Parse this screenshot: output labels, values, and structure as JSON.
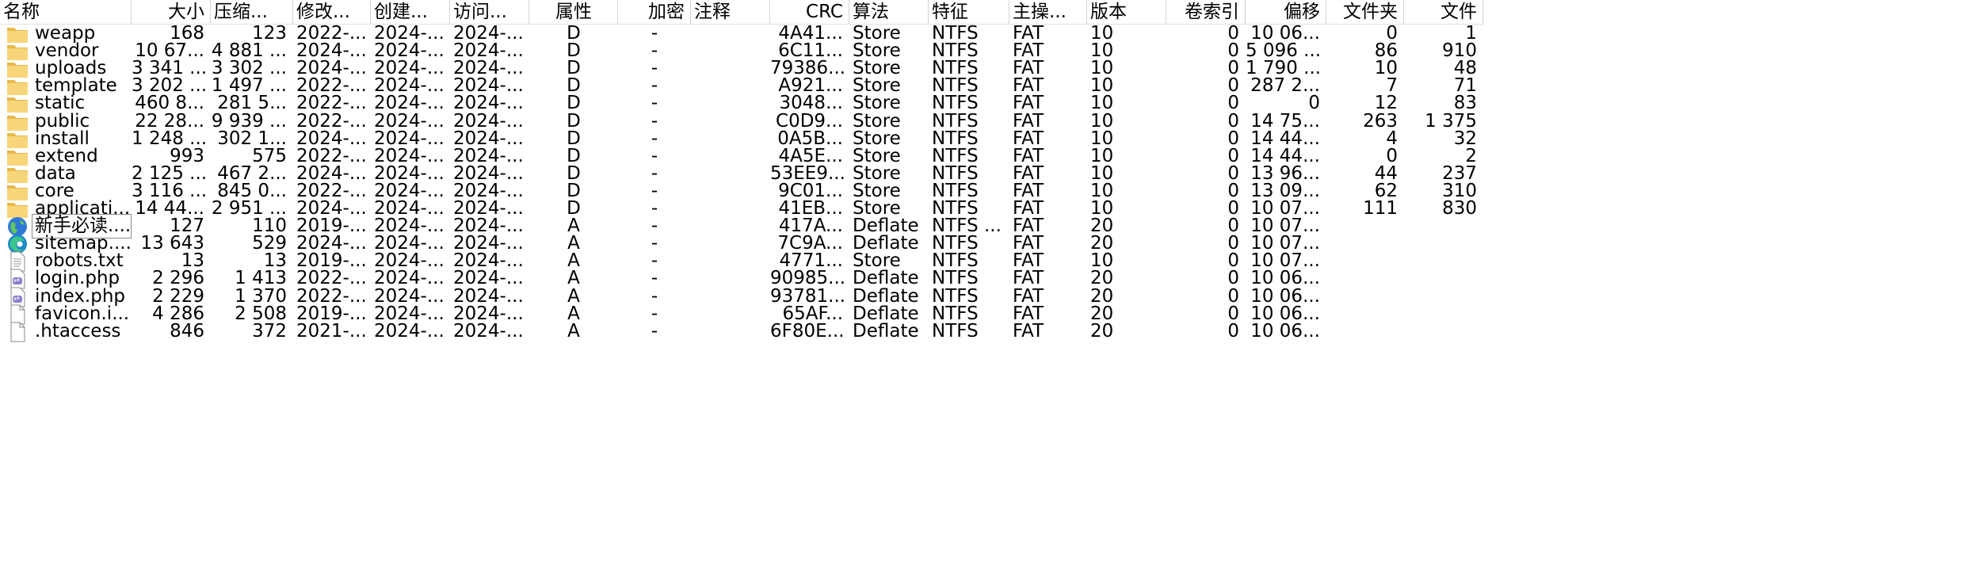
{
  "columns": [
    {
      "key": "name",
      "label": "名称"
    },
    {
      "key": "size",
      "label": "大小"
    },
    {
      "key": "packed",
      "label": "压缩..."
    },
    {
      "key": "modified",
      "label": "修改..."
    },
    {
      "key": "created",
      "label": "创建..."
    },
    {
      "key": "accessed",
      "label": "访问..."
    },
    {
      "key": "attr",
      "label": "属性"
    },
    {
      "key": "enc",
      "label": "加密"
    },
    {
      "key": "comment",
      "label": "注释"
    },
    {
      "key": "crc",
      "label": "CRC"
    },
    {
      "key": "method",
      "label": "算法"
    },
    {
      "key": "feature",
      "label": "特征"
    },
    {
      "key": "host",
      "label": "主操..."
    },
    {
      "key": "version",
      "label": "版本"
    },
    {
      "key": "volindex",
      "label": "卷索引"
    },
    {
      "key": "offset",
      "label": "偏移"
    },
    {
      "key": "folders",
      "label": "文件夹"
    },
    {
      "key": "files",
      "label": "文件"
    }
  ],
  "rows": [
    {
      "icon": "folder-icon",
      "name": "weapp",
      "size": "168",
      "packed": "123",
      "modified": "2022-...",
      "created": "2024-...",
      "accessed": "2024-...",
      "attr": "D",
      "enc": "-",
      "comment": "",
      "crc": "4A41...",
      "method": "Store",
      "feature": "NTFS",
      "host": "FAT",
      "version": "10",
      "volindex": "0",
      "offset": "10 06...",
      "folders": "0",
      "files": "1"
    },
    {
      "icon": "folder-icon",
      "name": "vendor",
      "size": "10 67...",
      "packed": "4 881 ...",
      "modified": "2024-...",
      "created": "2024-...",
      "accessed": "2024-...",
      "attr": "D",
      "enc": "-",
      "comment": "",
      "crc": "6C11...",
      "method": "Store",
      "feature": "NTFS",
      "host": "FAT",
      "version": "10",
      "volindex": "0",
      "offset": "5 096 ...",
      "folders": "86",
      "files": "910"
    },
    {
      "icon": "folder-icon",
      "name": "uploads",
      "size": "3 341 ...",
      "packed": "3 302 ...",
      "modified": "2024-...",
      "created": "2024-...",
      "accessed": "2024-...",
      "attr": "D",
      "enc": "-",
      "comment": "",
      "crc": "79386...",
      "method": "Store",
      "feature": "NTFS",
      "host": "FAT",
      "version": "10",
      "volindex": "0",
      "offset": "1 790 ...",
      "folders": "10",
      "files": "48"
    },
    {
      "icon": "folder-icon",
      "name": "template",
      "size": "3 202 ...",
      "packed": "1 497 ...",
      "modified": "2022-...",
      "created": "2024-...",
      "accessed": "2024-...",
      "attr": "D",
      "enc": "-",
      "comment": "",
      "crc": "A921...",
      "method": "Store",
      "feature": "NTFS",
      "host": "FAT",
      "version": "10",
      "volindex": "0",
      "offset": "287 2...",
      "folders": "7",
      "files": "71"
    },
    {
      "icon": "folder-icon",
      "name": "static",
      "size": "460 8...",
      "packed": "281 5...",
      "modified": "2022-...",
      "created": "2024-...",
      "accessed": "2024-...",
      "attr": "D",
      "enc": "-",
      "comment": "",
      "crc": "3048...",
      "method": "Store",
      "feature": "NTFS",
      "host": "FAT",
      "version": "10",
      "volindex": "0",
      "offset": "0",
      "folders": "12",
      "files": "83"
    },
    {
      "icon": "folder-icon",
      "name": "public",
      "size": "22 28...",
      "packed": "9 939 ...",
      "modified": "2022-...",
      "created": "2024-...",
      "accessed": "2024-...",
      "attr": "D",
      "enc": "-",
      "comment": "",
      "crc": "C0D9...",
      "method": "Store",
      "feature": "NTFS",
      "host": "FAT",
      "version": "10",
      "volindex": "0",
      "offset": "14 75...",
      "folders": "263",
      "files": "1 375"
    },
    {
      "icon": "folder-icon",
      "name": "install",
      "size": "1 248 ...",
      "packed": "302 1...",
      "modified": "2024-...",
      "created": "2024-...",
      "accessed": "2024-...",
      "attr": "D",
      "enc": "-",
      "comment": "",
      "crc": "0A5B...",
      "method": "Store",
      "feature": "NTFS",
      "host": "FAT",
      "version": "10",
      "volindex": "0",
      "offset": "14 44...",
      "folders": "4",
      "files": "32"
    },
    {
      "icon": "folder-icon",
      "name": "extend",
      "size": "993",
      "packed": "575",
      "modified": "2022-...",
      "created": "2024-...",
      "accessed": "2024-...",
      "attr": "D",
      "enc": "-",
      "comment": "",
      "crc": "4A5E...",
      "method": "Store",
      "feature": "NTFS",
      "host": "FAT",
      "version": "10",
      "volindex": "0",
      "offset": "14 44...",
      "folders": "0",
      "files": "2"
    },
    {
      "icon": "folder-icon",
      "name": "data",
      "size": "2 125 ...",
      "packed": "467 2...",
      "modified": "2024-...",
      "created": "2024-...",
      "accessed": "2024-...",
      "attr": "D",
      "enc": "-",
      "comment": "",
      "crc": "53EE9...",
      "method": "Store",
      "feature": "NTFS",
      "host": "FAT",
      "version": "10",
      "volindex": "0",
      "offset": "13 96...",
      "folders": "44",
      "files": "237"
    },
    {
      "icon": "folder-icon",
      "name": "core",
      "size": "3 116 ...",
      "packed": "845 0...",
      "modified": "2022-...",
      "created": "2024-...",
      "accessed": "2024-...",
      "attr": "D",
      "enc": "-",
      "comment": "",
      "crc": "9C01...",
      "method": "Store",
      "feature": "NTFS",
      "host": "FAT",
      "version": "10",
      "volindex": "0",
      "offset": "13 09...",
      "folders": "62",
      "files": "310"
    },
    {
      "icon": "folder-icon",
      "name": "applicati...",
      "size": "14 44...",
      "packed": "2 951 ...",
      "modified": "2024-...",
      "created": "2024-...",
      "accessed": "2024-...",
      "attr": "D",
      "enc": "-",
      "comment": "",
      "crc": "41EB...",
      "method": "Store",
      "feature": "NTFS",
      "host": "FAT",
      "version": "10",
      "volindex": "0",
      "offset": "10 07...",
      "folders": "111",
      "files": "830"
    },
    {
      "icon": "globe-html-icon",
      "name": "新手必读....",
      "size": "127",
      "packed": "110",
      "modified": "2019-...",
      "created": "2024-...",
      "accessed": "2024-...",
      "attr": "A",
      "enc": "-",
      "comment": "",
      "crc": "417A...",
      "method": "Deflate",
      "feature": "NTFS ...",
      "host": "FAT",
      "version": "20",
      "volindex": "0",
      "offset": "10 07...",
      "folders": "",
      "files": ""
    },
    {
      "icon": "edge-browser-icon",
      "name": "sitemap....",
      "size": "13 643",
      "packed": "529",
      "modified": "2024-...",
      "created": "2024-...",
      "accessed": "2024-...",
      "attr": "A",
      "enc": "-",
      "comment": "",
      "crc": "7C9A...",
      "method": "Deflate",
      "feature": "NTFS",
      "host": "FAT",
      "version": "20",
      "volindex": "0",
      "offset": "10 07...",
      "folders": "",
      "files": ""
    },
    {
      "icon": "text-file-icon",
      "name": "robots.txt",
      "size": "13",
      "packed": "13",
      "modified": "2019-...",
      "created": "2024-...",
      "accessed": "2024-...",
      "attr": "A",
      "enc": "-",
      "comment": "",
      "crc": "4771...",
      "method": "Store",
      "feature": "NTFS",
      "host": "FAT",
      "version": "10",
      "volindex": "0",
      "offset": "10 07...",
      "folders": "",
      "files": ""
    },
    {
      "icon": "php-file-icon",
      "name": "login.php",
      "size": "2 296",
      "packed": "1 413",
      "modified": "2022-...",
      "created": "2024-...",
      "accessed": "2024-...",
      "attr": "A",
      "enc": "-",
      "comment": "",
      "crc": "90985...",
      "method": "Deflate",
      "feature": "NTFS",
      "host": "FAT",
      "version": "20",
      "volindex": "0",
      "offset": "10 06...",
      "folders": "",
      "files": ""
    },
    {
      "icon": "php-file-icon",
      "name": "index.php",
      "size": "2 229",
      "packed": "1 370",
      "modified": "2022-...",
      "created": "2024-...",
      "accessed": "2024-...",
      "attr": "A",
      "enc": "-",
      "comment": "",
      "crc": "93781...",
      "method": "Deflate",
      "feature": "NTFS",
      "host": "FAT",
      "version": "20",
      "volindex": "0",
      "offset": "10 06...",
      "folders": "",
      "files": ""
    },
    {
      "icon": "blank-file-icon",
      "name": "favicon.i...",
      "size": "4 286",
      "packed": "2 508",
      "modified": "2019-...",
      "created": "2024-...",
      "accessed": "2024-...",
      "attr": "A",
      "enc": "-",
      "comment": "",
      "crc": "65AF...",
      "method": "Deflate",
      "feature": "NTFS",
      "host": "FAT",
      "version": "20",
      "volindex": "0",
      "offset": "10 06...",
      "folders": "",
      "files": ""
    },
    {
      "icon": "blank-file-icon",
      "name": ".htaccess",
      "size": "846",
      "packed": "372",
      "modified": "2021-...",
      "created": "2024-...",
      "accessed": "2024-...",
      "attr": "A",
      "enc": "-",
      "comment": "",
      "crc": "6F80E...",
      "method": "Deflate",
      "feature": "NTFS",
      "host": "FAT",
      "version": "20",
      "volindex": "0",
      "offset": "10 06...",
      "folders": "",
      "files": ""
    }
  ]
}
